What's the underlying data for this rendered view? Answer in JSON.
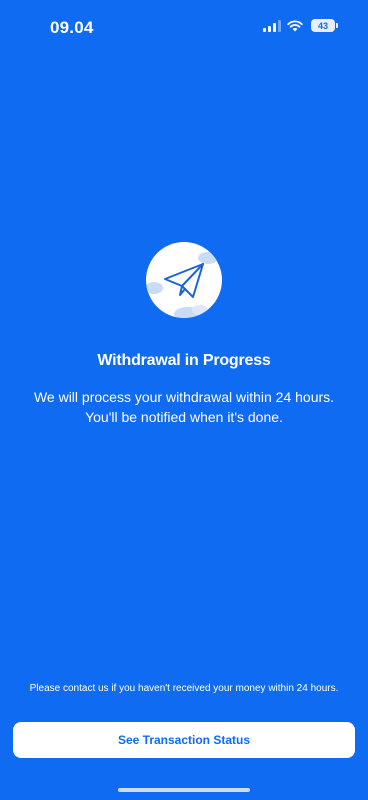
{
  "status_bar": {
    "time": "09.04",
    "battery": "43"
  },
  "main": {
    "title": "Withdrawal in Progress",
    "message_line_1": "We will process your withdrawal within 24 hours.",
    "message_line_2": "You'll be notified when it's done."
  },
  "footer": {
    "contact_note": "Please contact us if you haven't received your money within 24 hours.",
    "button_label": "See Transaction Status"
  },
  "icons": {
    "illustration": "paper-plane-icon",
    "signal": "cellular-signal-icon",
    "wifi": "wifi-icon",
    "battery": "battery-icon"
  },
  "colors": {
    "background": "#0F6BF2",
    "button_background": "#FFFFFF",
    "button_text": "#0F6BF2",
    "text": "#FFFFFF"
  }
}
